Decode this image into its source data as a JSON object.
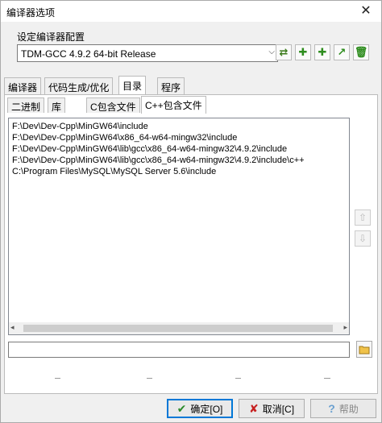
{
  "window": {
    "title": "编译器选项",
    "close_symbol": "✕"
  },
  "compiler_set": {
    "label": "设定编译器配置",
    "selected": "TDM-GCC 4.9.2 64-bit Release",
    "arrow": "⌵"
  },
  "toolbar_icons": [
    "swap-icon",
    "add-icon",
    "add-green-icon",
    "rename-icon",
    "delete-icon"
  ],
  "toolbar_glyphs": [
    "⇄",
    "✚",
    "✚",
    "↗",
    "🗑"
  ],
  "tabs": [
    {
      "label": "编译器"
    },
    {
      "label": "代码生成/优化"
    },
    {
      "label": "目录",
      "active": true
    },
    {
      "label": "程序"
    }
  ],
  "subtabs": [
    {
      "label": "二进制"
    },
    {
      "label": "库"
    },
    {
      "label": "C包含文件"
    },
    {
      "label": "C++包含文件",
      "active": true
    }
  ],
  "directories": [
    "F:\\Dev\\Dev-Cpp\\MinGW64\\include",
    "F:\\Dev\\Dev-Cpp\\MinGW64\\x86_64-w64-mingw32\\include",
    "F:\\Dev\\Dev-Cpp\\MinGW64\\lib\\gcc\\x86_64-w64-mingw32\\4.9.2\\include",
    "F:\\Dev\\Dev-Cpp\\MinGW64\\lib\\gcc\\x86_64-w64-mingw32\\4.9.2\\include\\c++",
    "C:\\Program Files\\MySQL\\MySQL Server 5.6\\include"
  ],
  "scroll": {
    "left": "◂",
    "right": "▸"
  },
  "side_buttons": {
    "up": "⇧",
    "down": "⇩"
  },
  "path_input": {
    "value": ""
  },
  "buttons": {
    "ok": {
      "glyph": "✔",
      "label": "确定[O]"
    },
    "cancel": {
      "glyph": "✘",
      "label": "取消[C]"
    },
    "help": {
      "glyph": "?",
      "label": "帮助"
    }
  },
  "colors": {
    "accent": "#0078d7",
    "ok": "#2a8a2a",
    "cancel": "#c62020"
  }
}
